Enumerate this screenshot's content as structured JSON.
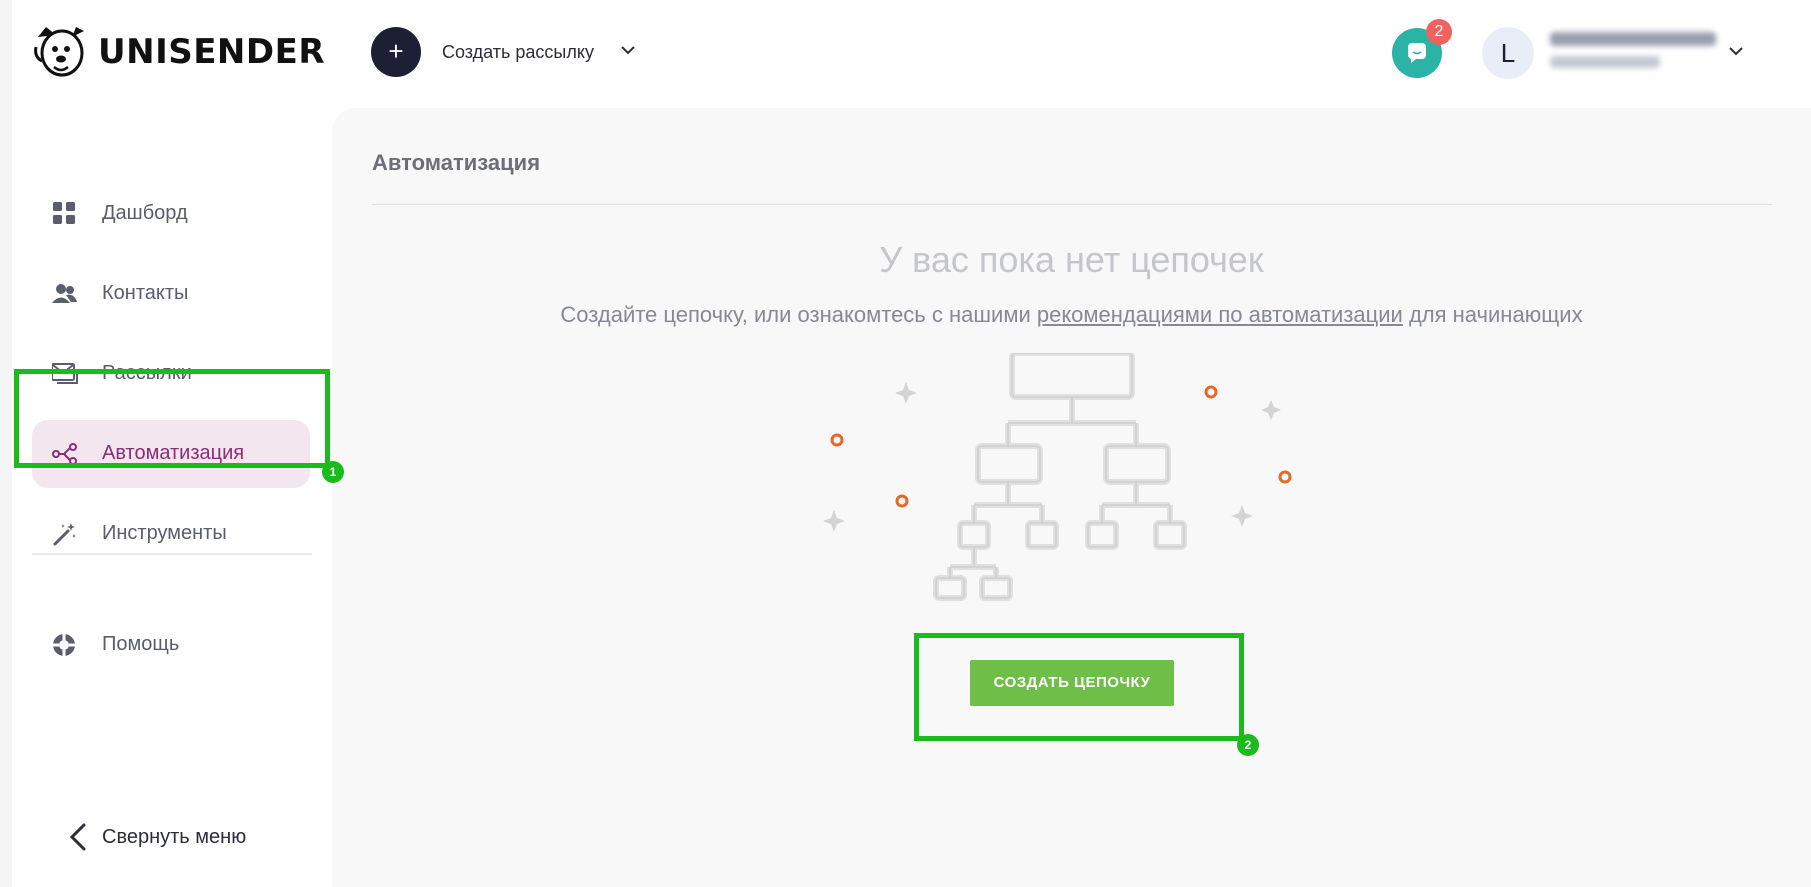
{
  "header": {
    "brand": "UNISENDER",
    "create_button_symbol": "+",
    "create_label": "Создать рассылку",
    "chat_badge_count": "2",
    "avatar_letter": "L"
  },
  "sidebar": {
    "items": [
      {
        "label": "Дашборд",
        "icon": "dashboard-grid-icon"
      },
      {
        "label": "Контакты",
        "icon": "contacts-people-icon"
      },
      {
        "label": "Рассылки",
        "icon": "mail-stack-icon"
      },
      {
        "label": "Автоматизация",
        "icon": "automation-share-icon",
        "active": true
      },
      {
        "label": "Инструменты",
        "icon": "magic-wand-icon"
      }
    ],
    "help": {
      "label": "Помощь",
      "icon": "lifebuoy-icon"
    },
    "collapse_label": "Свернуть меню"
  },
  "main": {
    "title": "Автоматизация",
    "empty_title": "У вас пока нет цепочек",
    "empty_sub_before": "Создайте цепочку, или ознакомтесь с нашими ",
    "empty_sub_link": "рекомендациями по автоматизации",
    "empty_sub_after": " для начинающих",
    "cta_label": "СОЗДАТЬ ЦЕПОЧКУ"
  },
  "annotations": [
    {
      "number": "1",
      "target": "sidebar-item-automation"
    },
    {
      "number": "2",
      "target": "create-chain-button"
    }
  ],
  "colors": {
    "accent_green": "#6fbe47",
    "highlight_green": "#1cbb1c",
    "active_purple": "#8a2d75",
    "active_bg": "#f3e6ef",
    "chat_teal": "#2bb3a6",
    "badge_red": "#f0625e",
    "dark_navy": "#1d1f35"
  }
}
